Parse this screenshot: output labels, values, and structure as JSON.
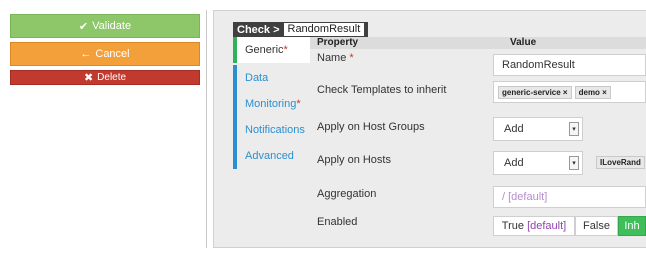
{
  "actions": {
    "validate": {
      "icon": "check-icon",
      "label": "Validate"
    },
    "cancel": {
      "icon": "arrow-left-icon",
      "label": "Cancel"
    },
    "delete": {
      "icon": "close-icon",
      "label": "Delete"
    }
  },
  "breadcrumb": {
    "prefix": "Check >",
    "name": "RandomResult"
  },
  "nav": {
    "items": [
      {
        "label": "Generic",
        "required": true,
        "active": true
      },
      {
        "label": "Data",
        "required": false
      },
      {
        "label": "Monitoring",
        "required": true
      },
      {
        "label": "Notifications",
        "required": false
      },
      {
        "label": "Advanced",
        "required": false
      }
    ]
  },
  "table": {
    "col_property": "Property",
    "col_value": "Value"
  },
  "fields": {
    "name": {
      "label": "Name",
      "required": true,
      "value": "RandomResult"
    },
    "templates": {
      "label": "Check Templates to inherit",
      "chips": [
        "generic-service ×",
        "demo ×"
      ]
    },
    "host_groups": {
      "label": "Apply on Host Groups",
      "select": "Add"
    },
    "hosts": {
      "label": "Apply on Hosts",
      "select": "Add",
      "chip": "ILoveRand"
    },
    "aggregation": {
      "label": "Aggregation",
      "placeholder": "/ [default]"
    },
    "enabled": {
      "label": "Enabled",
      "true_label": "True",
      "default_tag": "[default]",
      "false_label": "False",
      "inherit_label": "Inh"
    }
  },
  "colors": {
    "validate": "#8dc76a",
    "cancel": "#f4a03a",
    "delete": "#c23a2e",
    "nav_accent": "#2c8fd0",
    "active_accent": "#2fb35a"
  }
}
